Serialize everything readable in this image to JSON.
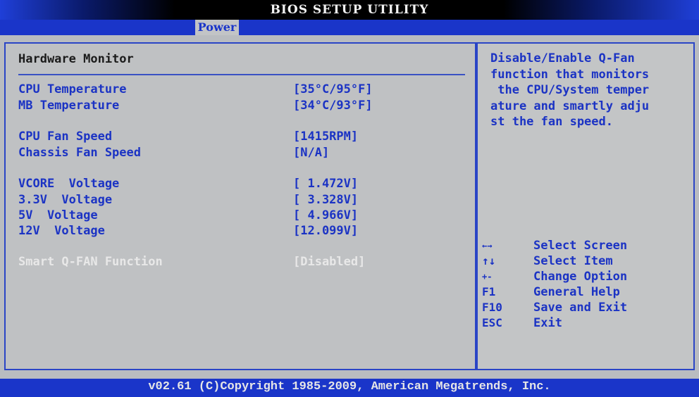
{
  "window": {
    "title": "BIOS SETUP UTILITY"
  },
  "menu": {
    "tabs": [
      {
        "label": "Power",
        "active": true
      }
    ]
  },
  "main": {
    "section_title": "Hardware Monitor",
    "temperatures": [
      {
        "label": "CPU Temperature",
        "value": "[35°C/95°F]"
      },
      {
        "label": "MB Temperature",
        "value": "[34°C/93°F]"
      }
    ],
    "fans": [
      {
        "label": "CPU Fan Speed",
        "value": "[1415RPM]"
      },
      {
        "label": "Chassis Fan Speed",
        "value": "[N/A]"
      }
    ],
    "voltages": [
      {
        "label": "VCORE  Voltage",
        "value": "[ 1.472V]"
      },
      {
        "label": "3.3V  Voltage",
        "value": "[ 3.328V]"
      },
      {
        "label": "5V  Voltage",
        "value": "[ 4.966V]"
      },
      {
        "label": "12V  Voltage",
        "value": "[12.099V]"
      }
    ],
    "smart_qfan": {
      "label": "Smart Q-FAN Function",
      "value": "[Disabled]",
      "state": "disabled"
    }
  },
  "help": {
    "lines": [
      "Disable/Enable Q-Fan",
      "function that monitors",
      " the CPU/System temper",
      "ature and smartly adju",
      "st the fan speed."
    ],
    "keys": [
      {
        "key": "←→",
        "icon": "left-right-arrows-icon",
        "desc": "Select Screen"
      },
      {
        "key": "↑↓",
        "icon": "up-down-arrows-icon",
        "desc": "Select Item"
      },
      {
        "key": "+-",
        "icon": "plus-minus-icon",
        "desc": "Change Option"
      },
      {
        "key": "F1",
        "desc": "General Help"
      },
      {
        "key": "F10",
        "desc": "Save and Exit"
      },
      {
        "key": "ESC",
        "desc": "Exit"
      }
    ]
  },
  "footer": {
    "text": "v02.61 (C)Copyright 1985-2009, American Megatrends, Inc."
  },
  "colors": {
    "accent_blue": "#1a35c9",
    "text_blue": "#1b33c4",
    "panel_gray": "#bfc1c3",
    "disabled_text": "#e8e8e8"
  }
}
